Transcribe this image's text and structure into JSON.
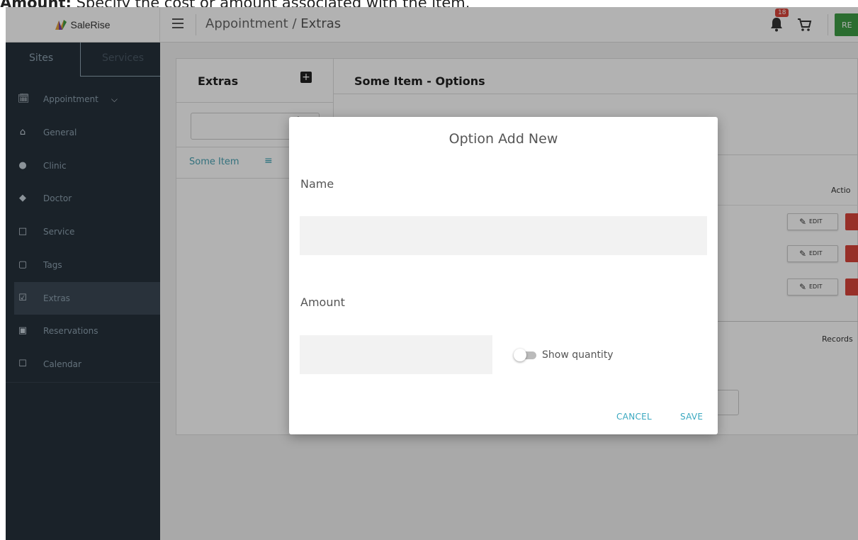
{
  "caption": {
    "bold": "Amount:",
    "rest": " Specify the cost or amount associated with the item."
  },
  "brand": {
    "name": "SaleRise"
  },
  "breadcrumb": {
    "parent": "Appointment",
    "separator": " / ",
    "current": "Extras"
  },
  "header": {
    "notification_count": "18",
    "right_button": "RE"
  },
  "sidebar": {
    "tabs": [
      "Sites",
      "Services"
    ],
    "items": [
      {
        "label": "Appointment",
        "icon": "calendar-check-icon"
      },
      {
        "label": "General",
        "icon": "home-icon"
      },
      {
        "label": "Clinic",
        "icon": "map-pin-icon"
      },
      {
        "label": "Doctor",
        "icon": "layers-icon"
      },
      {
        "label": "Service",
        "icon": "book-icon"
      },
      {
        "label": "Tags",
        "icon": "tag-icon"
      },
      {
        "label": "Extras",
        "icon": "checkbox-stack-icon"
      },
      {
        "label": "Reservations",
        "icon": "clipboard-icon"
      },
      {
        "label": "Calendar",
        "icon": "calendar-icon"
      }
    ]
  },
  "extras_panel": {
    "title": "Extras",
    "items": [
      "Some Item"
    ]
  },
  "options_panel": {
    "title": "Some Item - Options",
    "action_header": "Actio",
    "edit_label": "EDIT",
    "records_label": "Records"
  },
  "modal": {
    "title": "Option Add New",
    "name_label": "Name",
    "name_value": "",
    "amount_label": "Amount",
    "amount_value": "",
    "toggle_label": "Show quantity",
    "cancel_label": "CANCEL",
    "save_label": "SAVE"
  },
  "colors": {
    "sidebar_bg": "#26313c",
    "accent": "#3aa8c0",
    "danger": "#d9443a",
    "success": "#3e9d45"
  }
}
